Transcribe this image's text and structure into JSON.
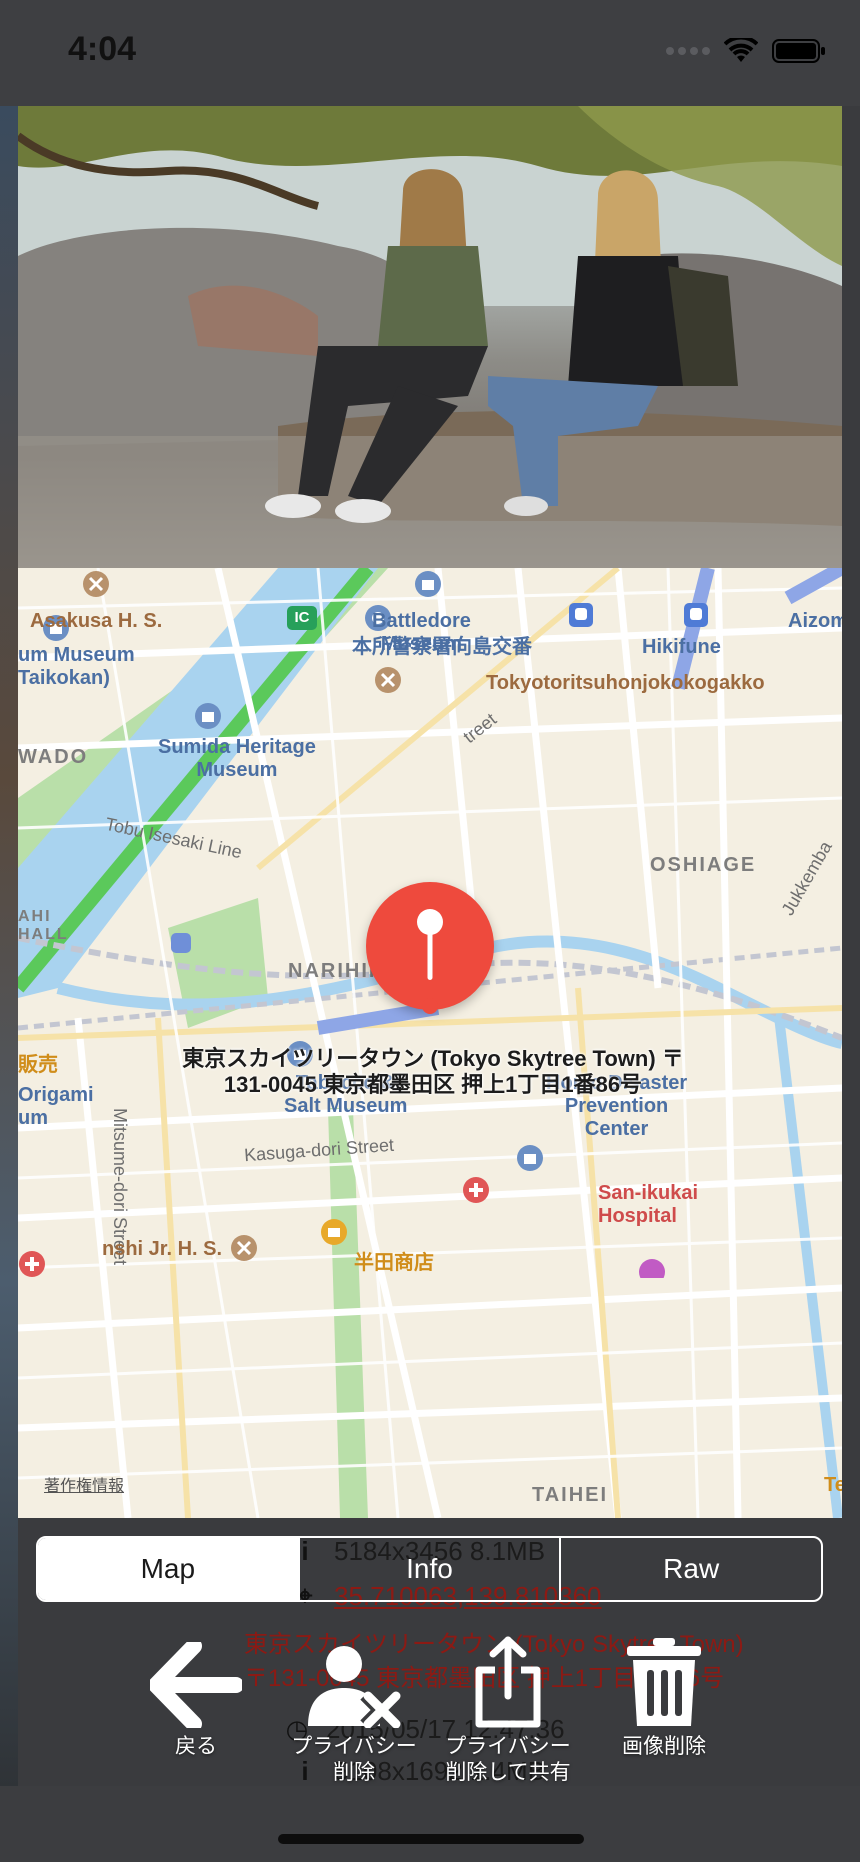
{
  "status": {
    "time": "4:04"
  },
  "background_info": {
    "size": "5184x3456 8.1MB",
    "coords": "35.710063,139.810360",
    "address_line1": "東京スカイツリータウン (Tokyo Skytree Town)",
    "address_line2": "〒131-0045 東京都墨田区 押上1丁目1番86号",
    "datetime": "2015/05/17 12:47:36",
    "size2": "5108x1692 1.4MB"
  },
  "map": {
    "labels": {
      "asakusa": "Asakusa H. S.",
      "battledore": "Battledore\nMuseum",
      "hikifune": "Hikifune",
      "aizom": "Aizom",
      "taikokan": "um Museum\nTaikokan)",
      "police": "本所警察署向島交番",
      "school": "Tokyotoritsuhonjokokogakko",
      "street_top": "treet",
      "wado": "WADO",
      "sumida": "Sumida Heritage\nMuseum",
      "tobu": "Tobu Isesaki Line",
      "oshiage": "OSHIAGE",
      "jukkemba": "Jukkemba",
      "ahi": "AHI\nHALL",
      "narihira": "NARIHIRA",
      "hanbai": "販売",
      "origami": "Origami\num",
      "mitsume": "Mitsume-dori Street",
      "tabacco": "Tabacco &\nSalt Museum",
      "honjo": "Honjo Disaster\nPrevention\nCenter",
      "kasuga": "Kasuga-dori Street",
      "sanikukai": "San-ikukai\nHospital",
      "handa": "半田商店",
      "kinshi": "nshi Jr. H. S.",
      "taihei": "TAIHEI",
      "te": "Te",
      "ic": "IC"
    },
    "pin_address": "東京スカイツリータウン (Tokyo Skytree Town) 〒131-0045 東京都墨田区 押上1丁目1番86号",
    "legal": "著作権情報"
  },
  "tabs": [
    "Map",
    "Info",
    "Raw"
  ],
  "active_tab": "Map",
  "toolbar": {
    "back": "戻る",
    "privacy_delete": "プライバシー\n削除",
    "privacy_share": "プライバシー\n削除して共有",
    "delete_image": "画像削除"
  },
  "colors": {
    "pin": "#ee4a3d",
    "map_bg": "#f4efe2",
    "water": "#a9d3ef",
    "park": "#b9dfa9"
  }
}
